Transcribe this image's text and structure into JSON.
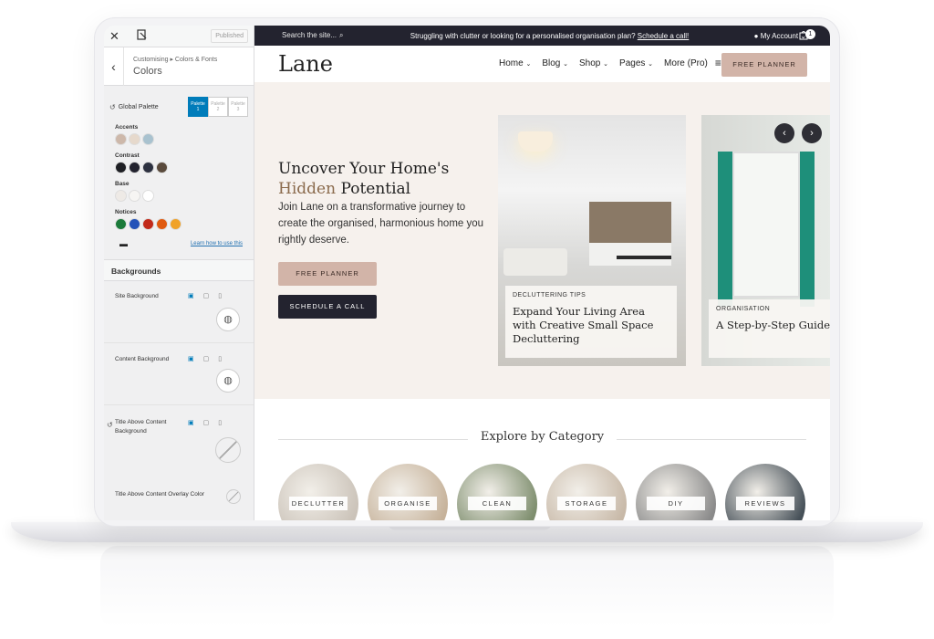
{
  "sidebar": {
    "published_label": "Published",
    "breadcrumb": "Customising ▸ Colors & Fonts",
    "section_title": "Colors",
    "global_palette_label": "Global Palette",
    "palette_tabs": [
      "Palette 1",
      "Palette 2",
      "Palette 3"
    ],
    "groups": [
      {
        "title": "Accents",
        "colors": [
          "#cdb8aa",
          "#e6d9cc",
          "#a9c2cf"
        ]
      },
      {
        "title": "Contrast",
        "colors": [
          "#1e1f24",
          "#23232f",
          "#2d3140",
          "#5a4a3c"
        ]
      },
      {
        "title": "Base",
        "colors": [
          "#eeeae6",
          "#f6f5f3",
          "#ffffff"
        ]
      },
      {
        "title": "Notices",
        "colors": [
          "#1b7a3a",
          "#2352b8",
          "#c22a1a",
          "#e05a10",
          "#f0a228"
        ]
      }
    ],
    "learn_link": "Learn how to use this",
    "backgrounds_title": "Backgrounds",
    "site_background": "Site Background",
    "content_background": "Content Background",
    "title_above_background": "Title Above Content Background",
    "title_above_overlay": "Title Above Content Overlay Color"
  },
  "topbar": {
    "search_placeholder": "Search the site...",
    "message": "Struggling with clutter or looking for a personalised organisation plan?",
    "message_link": "Schedule a call!",
    "account": "My Account",
    "cart_count": "1"
  },
  "header": {
    "logo": "Lane",
    "nav": [
      "Home",
      "Blog",
      "Shop",
      "Pages",
      "More (Pro)"
    ],
    "cta": "FREE PLANNER"
  },
  "hero": {
    "title_line1": "Uncover Your Home's",
    "title_highlight": "Hidden",
    "title_rest": "Potential",
    "body": "Join Lane on a transformative journey to create the organised, harmonious home you rightly deserve.",
    "btn_primary": "FREE PLANNER",
    "btn_secondary": "SCHEDULE A CALL"
  },
  "cards": [
    {
      "tag": "DECLUTTERING TIPS",
      "title": "Expand Your Living Area with Creative Small Space Decluttering"
    },
    {
      "tag": "ORGANISATION",
      "title": "A Step-by-Step Guide Perfect Wardrobe Res"
    }
  ],
  "explore_title": "Explore by Category",
  "categories": [
    {
      "label": "DECLUTTER",
      "color": "#cbc3b9"
    },
    {
      "label": "ORGANISE",
      "color": "#c6b29a"
    },
    {
      "label": "CLEAN",
      "color": "#7e8e6e"
    },
    {
      "label": "STORAGE",
      "color": "#c8b9a8"
    },
    {
      "label": "DIY",
      "color": "#8a8a8a"
    },
    {
      "label": "REVIEWS",
      "color": "#465058"
    }
  ]
}
